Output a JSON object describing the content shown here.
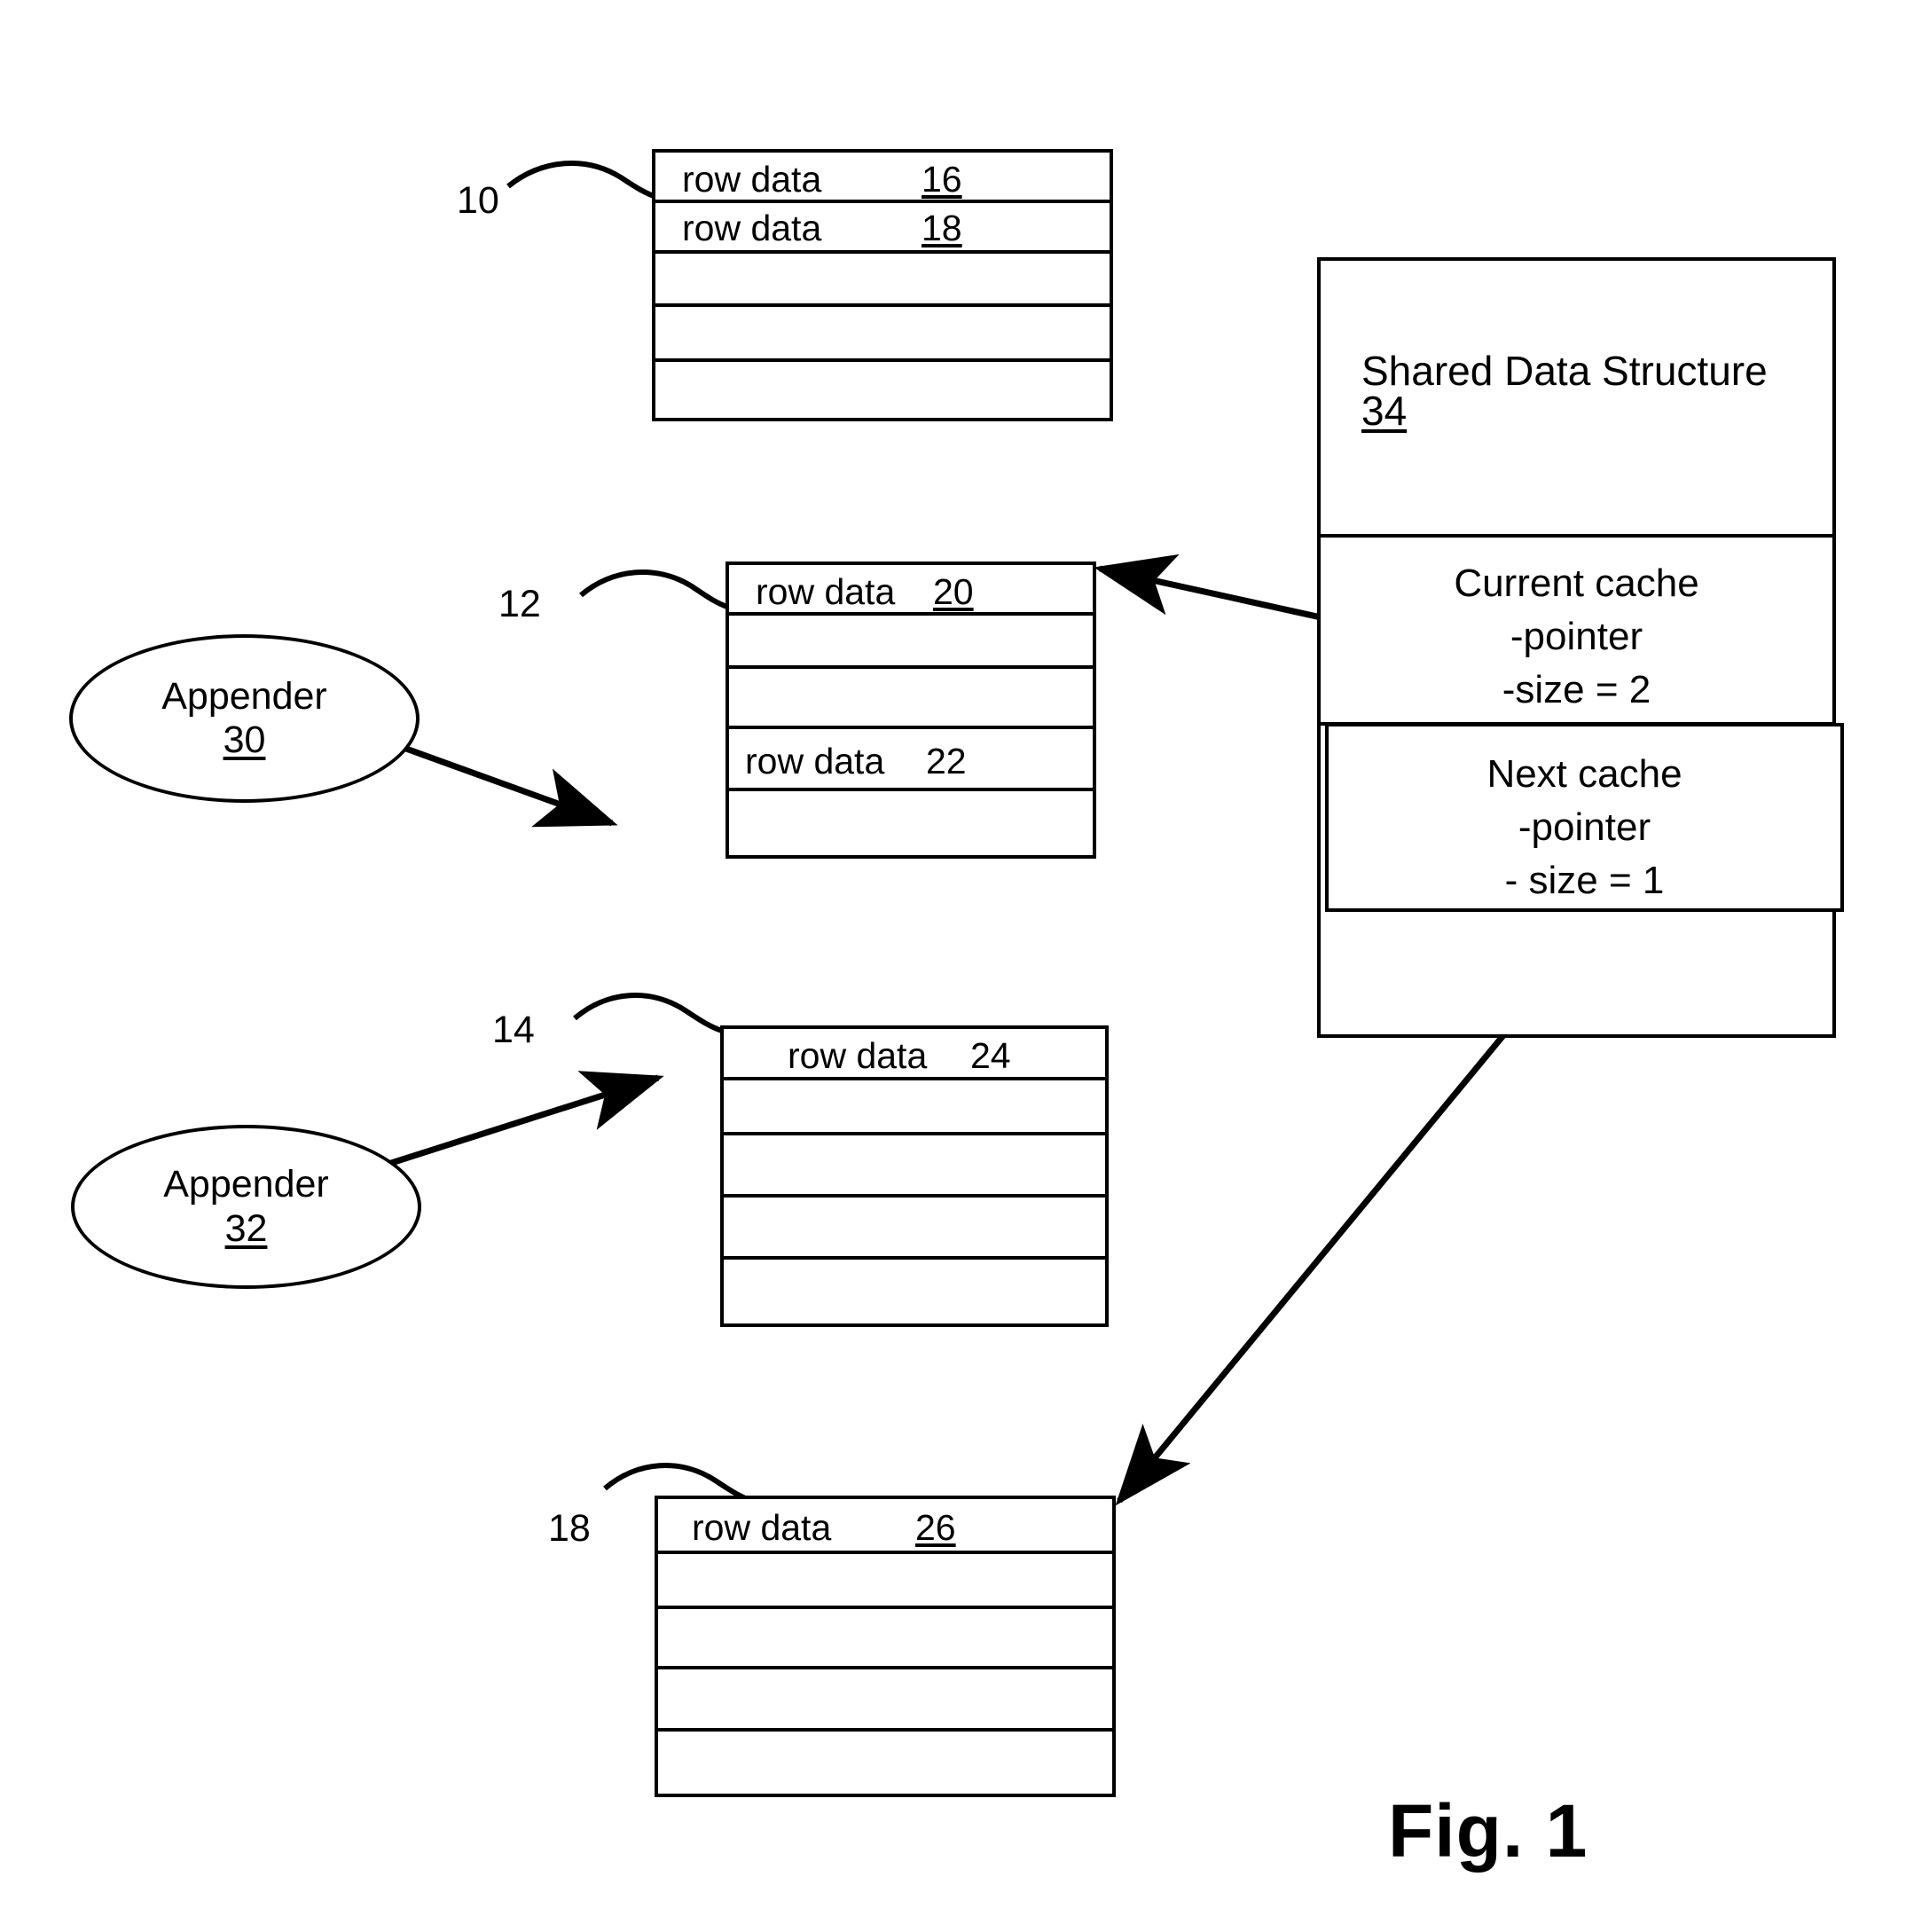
{
  "figure": {
    "caption": "Fig. 1",
    "row_data_label": "row data"
  },
  "caches": [
    {
      "ref": "10",
      "rows": [
        {
          "label": "row data",
          "ref": "16",
          "underlined": true
        },
        {
          "label": "row data",
          "ref": "18",
          "underlined": true
        },
        {
          "label": "",
          "ref": ""
        },
        {
          "label": "",
          "ref": ""
        },
        {
          "label": "",
          "ref": ""
        }
      ]
    },
    {
      "ref": "12",
      "rows": [
        {
          "label": "row data",
          "ref": "20",
          "underlined": true
        },
        {
          "label": "",
          "ref": ""
        },
        {
          "label": "",
          "ref": ""
        },
        {
          "label": "row data",
          "ref": "22",
          "underlined": false
        },
        {
          "label": "",
          "ref": ""
        }
      ]
    },
    {
      "ref": "14",
      "rows": [
        {
          "label": "row data",
          "ref": "24",
          "underlined": false
        },
        {
          "label": "",
          "ref": ""
        },
        {
          "label": "",
          "ref": ""
        },
        {
          "label": "",
          "ref": ""
        },
        {
          "label": "",
          "ref": ""
        }
      ]
    },
    {
      "ref": "18",
      "rows": [
        {
          "label": "row data",
          "ref": "26",
          "underlined": true
        },
        {
          "label": "",
          "ref": ""
        },
        {
          "label": "",
          "ref": ""
        },
        {
          "label": "",
          "ref": ""
        },
        {
          "label": "",
          "ref": ""
        }
      ]
    }
  ],
  "shared_data_structure": {
    "title": "Shared Data Structure",
    "ref": "34",
    "current_cache": {
      "name": "Current cache",
      "pointer": "-pointer",
      "size": "-size = 2"
    },
    "next_cache": {
      "name": "Next cache",
      "pointer": "-pointer",
      "size": "- size = 1"
    }
  },
  "appenders": [
    {
      "name": "Appender",
      "ref": "30"
    },
    {
      "name": "Appender",
      "ref": "32"
    }
  ],
  "colors": {
    "line": "#000000",
    "background": "#ffffff"
  }
}
